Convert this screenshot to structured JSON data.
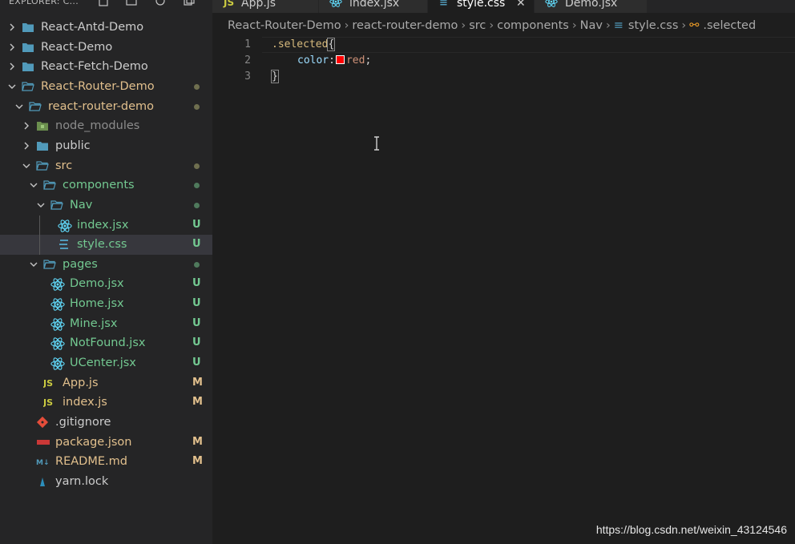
{
  "sidebar": {
    "title": "EXPLORER: C...",
    "tree": [
      {
        "label": "React-Antd-Demo",
        "kind": "folder-closed",
        "color": "#cccccc",
        "badge": ""
      },
      {
        "label": "React-Demo",
        "kind": "folder-closed",
        "color": "#cccccc",
        "badge": ""
      },
      {
        "label": "React-Fetch-Demo",
        "kind": "folder-closed",
        "color": "#cccccc",
        "badge": ""
      },
      {
        "label": "React-Router-Demo",
        "kind": "folder-open",
        "color": "#e2c08d",
        "badge": "dot"
      },
      {
        "label": "react-router-demo",
        "kind": "folder-open",
        "color": "#e2c08d",
        "badge": "dot"
      },
      {
        "label": "node_modules",
        "kind": "folder-closed-node",
        "color": "#8c8c8c",
        "badge": ""
      },
      {
        "label": "public",
        "kind": "folder-closed",
        "color": "#cccccc",
        "badge": ""
      },
      {
        "label": "src",
        "kind": "folder-open",
        "color": "#e2c08d",
        "badge": "dot"
      },
      {
        "label": "components",
        "kind": "folder-open",
        "color": "#73c991",
        "badge": "dot-green"
      },
      {
        "label": "Nav",
        "kind": "folder-open",
        "color": "#73c991",
        "badge": "dot-green"
      },
      {
        "label": "index.jsx",
        "kind": "react",
        "color": "#73c991",
        "badge": "U"
      },
      {
        "label": "style.css",
        "kind": "css",
        "color": "#73c991",
        "badge": "U"
      },
      {
        "label": "pages",
        "kind": "folder-open",
        "color": "#73c991",
        "badge": "dot-green"
      },
      {
        "label": "Demo.jsx",
        "kind": "react",
        "color": "#73c991",
        "badge": "U"
      },
      {
        "label": "Home.jsx",
        "kind": "react",
        "color": "#73c991",
        "badge": "U"
      },
      {
        "label": "Mine.jsx",
        "kind": "react",
        "color": "#73c991",
        "badge": "U"
      },
      {
        "label": "NotFound.jsx",
        "kind": "react",
        "color": "#73c991",
        "badge": "U"
      },
      {
        "label": "UCenter.jsx",
        "kind": "react",
        "color": "#73c991",
        "badge": "U"
      },
      {
        "label": "App.js",
        "kind": "js",
        "color": "#e2c08d",
        "badge": "M"
      },
      {
        "label": "index.js",
        "kind": "js",
        "color": "#e2c08d",
        "badge": "M"
      },
      {
        "label": ".gitignore",
        "kind": "git",
        "color": "#cccccc",
        "badge": ""
      },
      {
        "label": "package.json",
        "kind": "npm",
        "color": "#e2c08d",
        "badge": "M"
      },
      {
        "label": "README.md",
        "kind": "md",
        "color": "#e2c08d",
        "badge": "M"
      },
      {
        "label": "yarn.lock",
        "kind": "yarn",
        "color": "#cccccc",
        "badge": ""
      }
    ]
  },
  "tabs": [
    {
      "label": "App.js",
      "icon": "JS"
    },
    {
      "label": "index.jsx",
      "icon": "react"
    },
    {
      "label": "style.css",
      "icon": "css"
    },
    {
      "label": "Demo.jsx",
      "icon": "react"
    }
  ],
  "breadcrumb": [
    "React-Router-Demo",
    "react-router-demo",
    "src",
    "components",
    "Nav",
    "style.css",
    ".selected"
  ],
  "editor": {
    "line_numbers": [
      "1",
      "2",
      "3"
    ],
    "selector": ".selected",
    "open_brace": "{",
    "property": "color",
    "colon": ":",
    "value": "red",
    "semicolon": ";",
    "close_brace": "}"
  },
  "watermark": "https://blog.csdn.net/weixin_43124546",
  "colors": {
    "untracked": "#73c991",
    "modified": "#e2c08d",
    "swatch": "#ff0000"
  }
}
